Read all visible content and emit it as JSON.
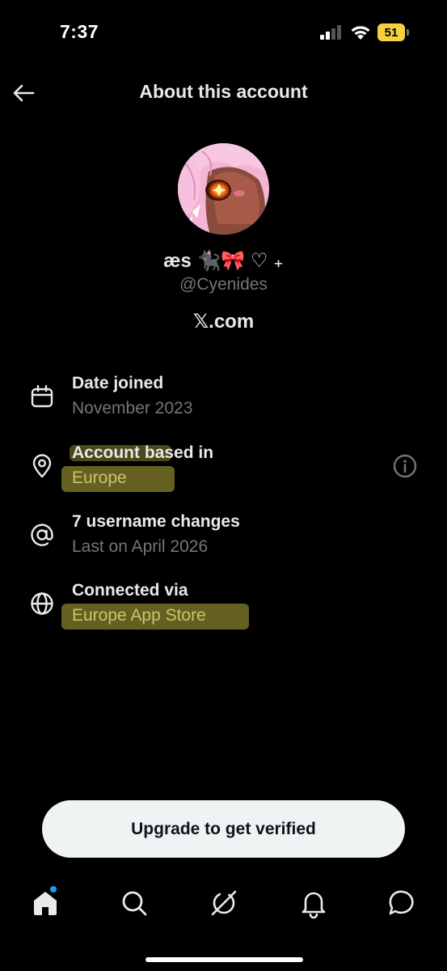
{
  "status_bar": {
    "time": "7:37",
    "battery_level": "51",
    "battery_color": "#f5d142"
  },
  "header": {
    "title": "About this account",
    "back_icon": "arrow-left-icon"
  },
  "profile": {
    "display_name": "æs 🐈‍⬛🎀 ♡ ₊",
    "handle": "@Cyenides",
    "site": "𝕏.com"
  },
  "info_rows": [
    {
      "icon": "calendar-icon",
      "title": "Date joined",
      "value": "November 2023"
    },
    {
      "icon": "location-pin-icon",
      "title": "Account based in",
      "value": "Europe",
      "trailing_icon": "info-icon"
    },
    {
      "icon": "at-sign-icon",
      "title": "7 username changes",
      "value": "Last on April 2026"
    },
    {
      "icon": "globe-icon",
      "title": "Connected via",
      "value": "Europe App Store"
    }
  ],
  "upgrade_button": {
    "label": "Upgrade to get verified"
  },
  "bottom_nav": {
    "items": [
      "home-icon",
      "search-icon",
      "grok-icon",
      "notifications-bell-icon",
      "messages-icon"
    ],
    "accent_color": "#1d9bf0"
  },
  "colors": {
    "background": "#000000",
    "primary_text": "#e7e9ea",
    "secondary_text": "#71767b",
    "highlight": "#f0e450"
  }
}
